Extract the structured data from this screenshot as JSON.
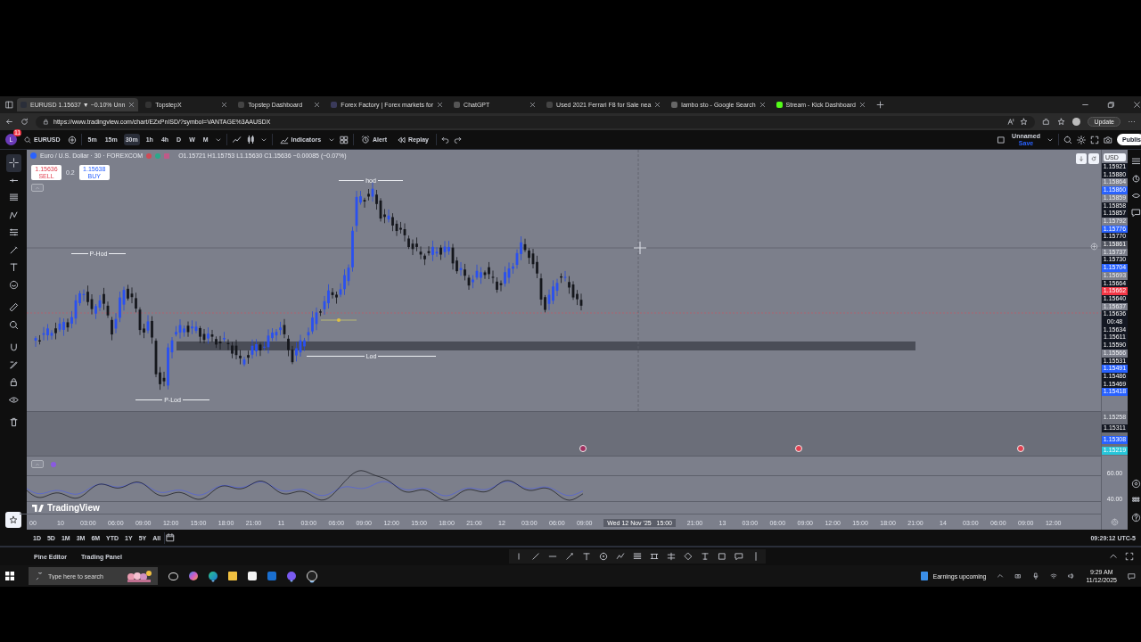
{
  "browser": {
    "tabs": [
      {
        "title": "EURUSD 1.15637 ▼ −0.10% Unn",
        "selected": true
      },
      {
        "title": "TopstepX",
        "selected": false
      },
      {
        "title": "Topstep Dashboard",
        "selected": false
      },
      {
        "title": "Forex Factory | Forex markets for",
        "selected": false
      },
      {
        "title": "ChatGPT",
        "selected": false
      },
      {
        "title": "Used 2021 Ferrari F8 for Sale nea",
        "selected": false
      },
      {
        "title": "lambo sto - Google Search",
        "selected": false
      },
      {
        "title": "Stream - Kick Dashboard",
        "selected": false
      }
    ],
    "url": "https://www.tradingview.com/chart/EZxPnISD/?symbol=VANTAGE%3AAUSDX",
    "update_button": "Update"
  },
  "toolbar": {
    "avatar": "L",
    "notification_count": "11",
    "symbol": "EURUSD",
    "intervals": [
      {
        "label": "5m",
        "selected": false
      },
      {
        "label": "15m",
        "selected": false
      },
      {
        "label": "30m",
        "selected": true
      },
      {
        "label": "1h",
        "selected": false
      },
      {
        "label": "4h",
        "selected": false
      },
      {
        "label": "D",
        "selected": false
      },
      {
        "label": "W",
        "selected": false
      },
      {
        "label": "M",
        "selected": false
      }
    ],
    "indicators": "Indicators",
    "alert": "Alert",
    "replay": "Replay",
    "layout_name": "Unnamed",
    "layout_status": "Save",
    "publish": "Publis"
  },
  "legend": {
    "title": "Euro / U.S. Dollar · 30 · FOREXCOM",
    "ohlc": "O1.15721 H1.15753 L1.15630 C1.15636 −0.00085 (−0.07%)"
  },
  "trade": {
    "sell_price": "1.15636",
    "sell": "SELL",
    "spread": "0.2",
    "buy_price": "1.15638",
    "buy": "BUY"
  },
  "levels": [
    {
      "label": "hod"
    },
    {
      "label": "P-Hod"
    },
    {
      "label": "Lod"
    },
    {
      "label": "P-Lod"
    }
  ],
  "price_axis": {
    "currency": "USD",
    "main_labels": [
      {
        "text": "1.15921",
        "kind": "dark"
      },
      {
        "text": "1.15880",
        "kind": "dark"
      },
      {
        "text": "1.15864",
        "kind": "plain"
      },
      {
        "text": "1.15860",
        "kind": "blue"
      },
      {
        "text": "1.15859",
        "kind": "plain"
      },
      {
        "text": "1.15858",
        "kind": "dark"
      },
      {
        "text": "1.15857",
        "kind": "dark"
      },
      {
        "text": "1.15792",
        "kind": "plain"
      },
      {
        "text": "1.15776",
        "kind": "blue"
      },
      {
        "text": "1.15770",
        "kind": "dark"
      },
      {
        "text": "1.15861",
        "kind": "crosshair"
      },
      {
        "text": "1.15737",
        "kind": "plain"
      },
      {
        "text": "1.15730",
        "kind": "dark"
      },
      {
        "text": "1.15704",
        "kind": "blue"
      },
      {
        "text": "1.15693",
        "kind": "plain"
      },
      {
        "text": "1.15664",
        "kind": "dark"
      },
      {
        "text": "1.15662",
        "kind": "red"
      },
      {
        "text": "1.15640",
        "kind": "dark"
      },
      {
        "text": "1.15637",
        "kind": "plain"
      },
      {
        "text": "1.15636",
        "kind": "dark",
        "countdown": "00:48"
      },
      {
        "text": "1.15634",
        "kind": "dark"
      },
      {
        "text": "1.15611",
        "kind": "dark"
      },
      {
        "text": "1.15590",
        "kind": "dark"
      },
      {
        "text": "1.15566",
        "kind": "plain"
      },
      {
        "text": "1.15531",
        "kind": "dark"
      },
      {
        "text": "1.15491",
        "kind": "blue"
      },
      {
        "text": "1.15486",
        "kind": "dark"
      },
      {
        "text": "1.15469",
        "kind": "dark"
      },
      {
        "text": "1.15418",
        "kind": "blue"
      }
    ],
    "lower_labels": [
      {
        "text": "1.15258",
        "kind": "plain"
      },
      {
        "text": "1.15311",
        "kind": "dark"
      },
      {
        "text": "1.15308",
        "kind": "blue"
      },
      {
        "text": "1.15219",
        "kind": "teal"
      }
    ],
    "rsi_labels": [
      "60.00",
      "40.00"
    ]
  },
  "time_axis": {
    "labels": [
      {
        "text": "00",
        "kind": "tick"
      },
      {
        "text": "10",
        "kind": "tick"
      },
      {
        "text": "03:00",
        "kind": "tick"
      },
      {
        "text": "06:00",
        "kind": "tick"
      },
      {
        "text": "09:00",
        "kind": "tick"
      },
      {
        "text": "12:00",
        "kind": "tick"
      },
      {
        "text": "15:00",
        "kind": "tick"
      },
      {
        "text": "18:00",
        "kind": "tick"
      },
      {
        "text": "21:00",
        "kind": "tick"
      },
      {
        "text": "11",
        "kind": "tick"
      },
      {
        "text": "03:00",
        "kind": "tick"
      },
      {
        "text": "06:00",
        "kind": "tick"
      },
      {
        "text": "09:00",
        "kind": "tick"
      },
      {
        "text": "12:00",
        "kind": "tick"
      },
      {
        "text": "15:00",
        "kind": "tick"
      },
      {
        "text": "18:00",
        "kind": "tick"
      },
      {
        "text": "21:00",
        "kind": "tick"
      },
      {
        "text": "12",
        "kind": "tick"
      },
      {
        "text": "03:00",
        "kind": "tick"
      },
      {
        "text": "06:00",
        "kind": "tick"
      },
      {
        "text": "09:00",
        "kind": "tick"
      },
      {
        "text": "Wed 12 Nov '25   15:00",
        "kind": "crosshair"
      },
      {
        "text": "21:00",
        "kind": "tick"
      },
      {
        "text": "13",
        "kind": "tick"
      },
      {
        "text": "03:00",
        "kind": "tick"
      },
      {
        "text": "06:00",
        "kind": "tick"
      },
      {
        "text": "09:00",
        "kind": "tick"
      },
      {
        "text": "12:00",
        "kind": "tick"
      },
      {
        "text": "15:00",
        "kind": "tick"
      },
      {
        "text": "18:00",
        "kind": "tick"
      },
      {
        "text": "21:00",
        "kind": "tick"
      },
      {
        "text": "14",
        "kind": "tick"
      },
      {
        "text": "03:00",
        "kind": "tick"
      },
      {
        "text": "06:00",
        "kind": "tick"
      },
      {
        "text": "09:00",
        "kind": "tick"
      },
      {
        "text": "12:00",
        "kind": "tick"
      }
    ]
  },
  "logo": "TradingView",
  "range_bar": {
    "ranges": [
      "1D",
      "5D",
      "1M",
      "3M",
      "6M",
      "YTD",
      "1Y",
      "5Y",
      "All"
    ],
    "clock": "09:29:12 UTC-5"
  },
  "panel_tabs": [
    "Pine Editor",
    "Trading Panel"
  ],
  "taskbar": {
    "search_placeholder": "Type here to search",
    "news": "Earnings upcoming",
    "time": "9:29 AM",
    "date": "11/12/2025"
  }
}
